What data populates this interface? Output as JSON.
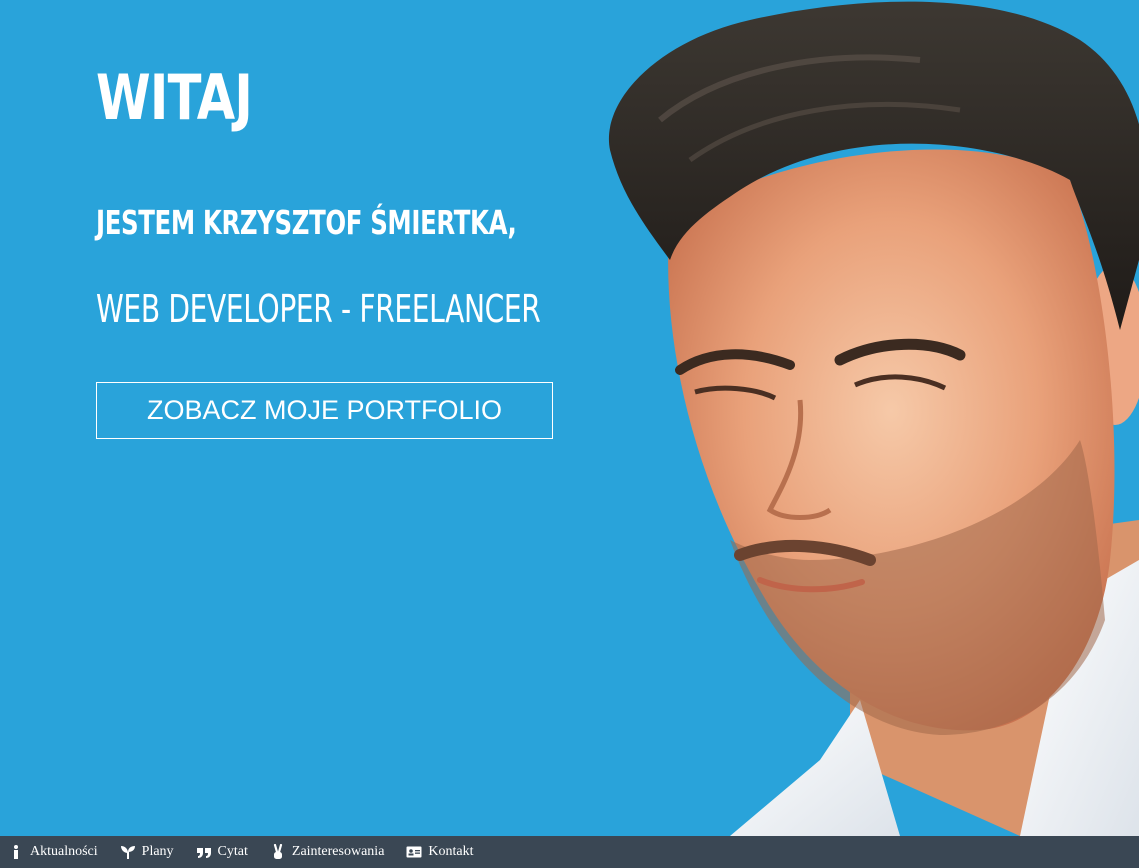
{
  "hero": {
    "title": "WITAJ",
    "name": "JESTEM KRZYSZTOF ŚMIERTKA,",
    "role": "WEB DEVELOPER - FREELANCER",
    "cta_label": "ZOBACZ MOJE PORTFOLIO"
  },
  "nav": {
    "items": [
      {
        "label": "Aktualności",
        "icon": "info-icon"
      },
      {
        "label": "Plany",
        "icon": "sprout-icon"
      },
      {
        "label": "Cytat",
        "icon": "quote-icon"
      },
      {
        "label": "Zainteresowania",
        "icon": "hand-peace-icon"
      },
      {
        "label": "Kontakt",
        "icon": "id-card-icon"
      }
    ]
  },
  "colors": {
    "hero_background": "#29a3da",
    "nav_background": "#3a4754",
    "text": "#ffffff"
  }
}
